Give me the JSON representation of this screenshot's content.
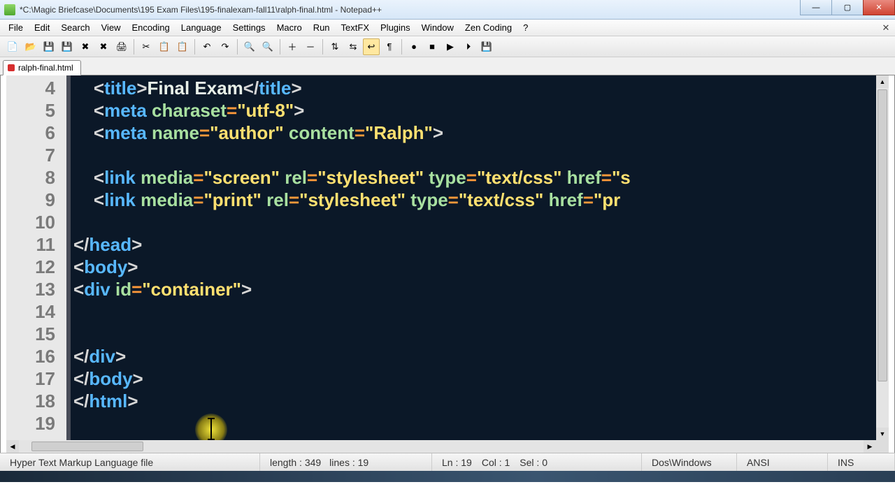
{
  "window": {
    "title": "*C:\\Magic Briefcase\\Documents\\195 Exam Files\\195-finalexam-fall11\\ralph-final.html - Notepad++"
  },
  "menu": {
    "items": [
      "File",
      "Edit",
      "Search",
      "View",
      "Encoding",
      "Language",
      "Settings",
      "Macro",
      "Run",
      "TextFX",
      "Plugins",
      "Window",
      "Zen Coding",
      "?"
    ]
  },
  "tab": {
    "label": "ralph-final.html"
  },
  "gutter": {
    "start": 4,
    "end": 19
  },
  "code": {
    "lines": [
      {
        "n": 4,
        "indent": 4,
        "tokens": [
          [
            "punct",
            "<"
          ],
          [
            "tag",
            "title"
          ],
          [
            "punct",
            ">"
          ],
          [
            "text",
            "Final Exam"
          ],
          [
            "punct",
            "</"
          ],
          [
            "tag",
            "title"
          ],
          [
            "punct",
            ">"
          ]
        ]
      },
      {
        "n": 5,
        "indent": 4,
        "tokens": [
          [
            "punct",
            "<"
          ],
          [
            "tag",
            "meta"
          ],
          [
            "text",
            " "
          ],
          [
            "attr",
            "charaset"
          ],
          [
            "op",
            "="
          ],
          [
            "str",
            "\"utf-8\""
          ],
          [
            "punct",
            ">"
          ]
        ]
      },
      {
        "n": 6,
        "indent": 4,
        "tokens": [
          [
            "punct",
            "<"
          ],
          [
            "tag",
            "meta"
          ],
          [
            "text",
            " "
          ],
          [
            "attr",
            "name"
          ],
          [
            "op",
            "="
          ],
          [
            "str",
            "\"author\""
          ],
          [
            "text",
            " "
          ],
          [
            "attr",
            "content"
          ],
          [
            "op",
            "="
          ],
          [
            "str",
            "\"Ralph\""
          ],
          [
            "punct",
            ">"
          ]
        ]
      },
      {
        "n": 7,
        "indent": 0,
        "tokens": []
      },
      {
        "n": 8,
        "indent": 4,
        "tokens": [
          [
            "punct",
            "<"
          ],
          [
            "tag",
            "link"
          ],
          [
            "text",
            " "
          ],
          [
            "attr",
            "media"
          ],
          [
            "op",
            "="
          ],
          [
            "str",
            "\"screen\""
          ],
          [
            "text",
            " "
          ],
          [
            "attr",
            "rel"
          ],
          [
            "op",
            "="
          ],
          [
            "str",
            "\"stylesheet\""
          ],
          [
            "text",
            " "
          ],
          [
            "attr",
            "type"
          ],
          [
            "op",
            "="
          ],
          [
            "str",
            "\"text/css\""
          ],
          [
            "text",
            " "
          ],
          [
            "attr",
            "href"
          ],
          [
            "op",
            "="
          ],
          [
            "str",
            "\"s"
          ]
        ]
      },
      {
        "n": 9,
        "indent": 4,
        "tokens": [
          [
            "punct",
            "<"
          ],
          [
            "tag",
            "link"
          ],
          [
            "text",
            " "
          ],
          [
            "attr",
            "media"
          ],
          [
            "op",
            "="
          ],
          [
            "str",
            "\"print\""
          ],
          [
            "text",
            " "
          ],
          [
            "attr",
            "rel"
          ],
          [
            "op",
            "="
          ],
          [
            "str",
            "\"stylesheet\""
          ],
          [
            "text",
            " "
          ],
          [
            "attr",
            "type"
          ],
          [
            "op",
            "="
          ],
          [
            "str",
            "\"text/css\""
          ],
          [
            "text",
            " "
          ],
          [
            "attr",
            "href"
          ],
          [
            "op",
            "="
          ],
          [
            "str",
            "\"pr"
          ]
        ]
      },
      {
        "n": 10,
        "indent": 0,
        "tokens": []
      },
      {
        "n": 11,
        "indent": 0,
        "tokens": [
          [
            "punct",
            "</"
          ],
          [
            "tag",
            "head"
          ],
          [
            "punct",
            ">"
          ]
        ]
      },
      {
        "n": 12,
        "indent": 0,
        "fold": true,
        "tokens": [
          [
            "punct",
            "<"
          ],
          [
            "tag",
            "body"
          ],
          [
            "punct",
            ">"
          ]
        ]
      },
      {
        "n": 13,
        "indent": 0,
        "fold": true,
        "tokens": [
          [
            "punct",
            "<"
          ],
          [
            "tag",
            "div"
          ],
          [
            "text",
            " "
          ],
          [
            "attr",
            "id"
          ],
          [
            "op",
            "="
          ],
          [
            "str",
            "\"container\""
          ],
          [
            "punct",
            ">"
          ]
        ]
      },
      {
        "n": 14,
        "indent": 0,
        "tokens": []
      },
      {
        "n": 15,
        "indent": 0,
        "tokens": []
      },
      {
        "n": 16,
        "indent": 0,
        "tokens": [
          [
            "punct",
            "</"
          ],
          [
            "tag",
            "div"
          ],
          [
            "punct",
            ">"
          ]
        ]
      },
      {
        "n": 17,
        "indent": 0,
        "tokens": [
          [
            "punct",
            "</"
          ],
          [
            "tag",
            "body"
          ],
          [
            "punct",
            ">"
          ]
        ]
      },
      {
        "n": 18,
        "indent": 0,
        "tokens": [
          [
            "punct",
            "</"
          ],
          [
            "tag",
            "html"
          ],
          [
            "punct",
            ">"
          ]
        ]
      },
      {
        "n": 19,
        "indent": 0,
        "tokens": []
      }
    ]
  },
  "status": {
    "filetype": "Hyper Text Markup Language file",
    "length_label": "length : 349",
    "lines_label": "lines : 19",
    "ln": "Ln : 19",
    "col": "Col : 1",
    "sel": "Sel : 0",
    "eol": "Dos\\Windows",
    "encoding": "ANSI",
    "ins": "INS"
  },
  "toolbar": {
    "icons": [
      "new-file",
      "open-file",
      "save-file",
      "save-all",
      "close-file",
      "close-all",
      "print",
      "sep",
      "cut",
      "copy",
      "paste",
      "sep",
      "undo",
      "redo",
      "sep",
      "find",
      "replace",
      "sep",
      "zoom-in",
      "zoom-out",
      "sep",
      "sync-v",
      "sync-h",
      "word-wrap",
      "show-all",
      "sep",
      "macro-record",
      "macro-stop",
      "macro-play",
      "macro-play-multi",
      "macro-save"
    ]
  }
}
